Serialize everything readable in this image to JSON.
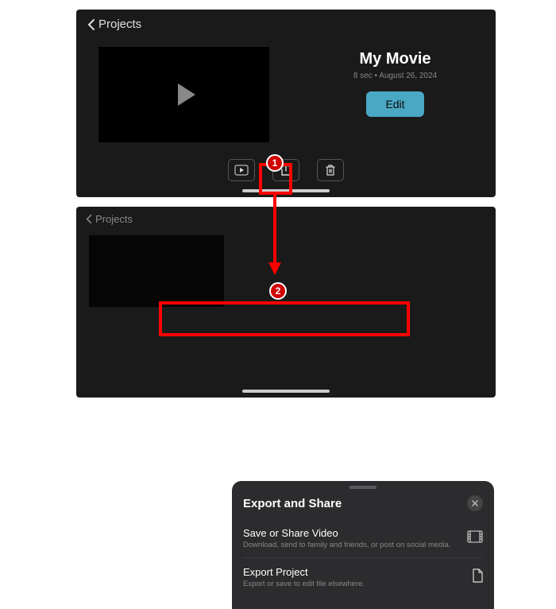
{
  "panel1": {
    "back_label": "Projects",
    "title": "My Movie",
    "meta": "8 sec • August 26, 2024",
    "edit_label": "Edit"
  },
  "panel2": {
    "back_label": "Projects"
  },
  "sheet": {
    "title": "Export and Share",
    "items": [
      {
        "title": "Save or Share Video",
        "subtitle": "Download, send to family and friends, or post on social media."
      },
      {
        "title": "Export Project",
        "subtitle": "Export or save to edit file elsewhere."
      }
    ]
  },
  "steps": {
    "one": "1",
    "two": "2"
  }
}
